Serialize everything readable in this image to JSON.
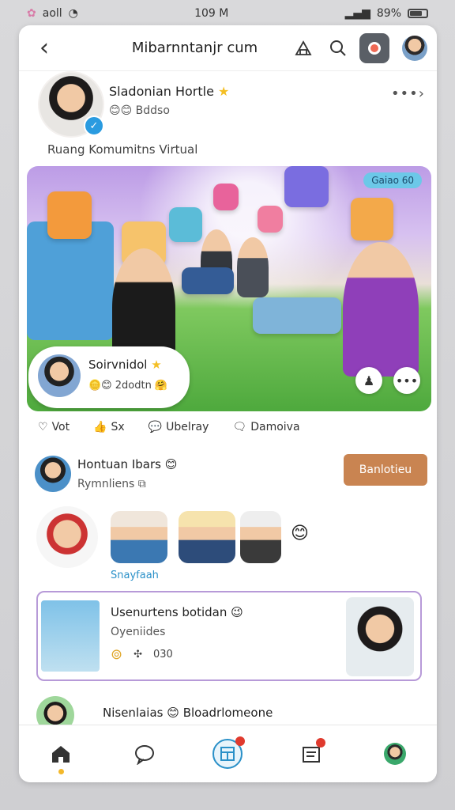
{
  "status_bar": {
    "left_text": "aoll",
    "time": "109 M",
    "battery": "89%"
  },
  "topbar": {
    "site": "Mibarnntanjr cum",
    "back_icon": "back-arrow-icon"
  },
  "profile": {
    "name": "Sladonian Hortle",
    "sub": "Bddso",
    "tagline": "Ruang Komumitns Virtual"
  },
  "hero": {
    "badge": "Gaiao 60",
    "overlay": {
      "name": "Soirvnidol",
      "sub": "2dodtn"
    }
  },
  "actions": [
    {
      "icon": "heart-icon",
      "label": "Vot"
    },
    {
      "icon": "thumbs-up-icon",
      "label": "Sx"
    },
    {
      "icon": "comment-icon",
      "label": "Ubelray"
    },
    {
      "icon": "message-icon",
      "label": "Damoiva"
    }
  ],
  "post2": {
    "name": "Hontuan Ibars",
    "sub": "Rymnliens",
    "follow_label": "Banlotieu"
  },
  "stories": {
    "label": "Snayfaah"
  },
  "featured": {
    "title": "Usenurtens botidan",
    "sub": "Oyeniides",
    "meta_count": "030"
  },
  "peek": {
    "text": "Nisenlaias",
    "text2": "Bloadrlomeone"
  },
  "tabs": [
    {
      "name": "home",
      "icon": "home-icon"
    },
    {
      "name": "chat",
      "icon": "chat-icon"
    },
    {
      "name": "center",
      "icon": "grid-icon"
    },
    {
      "name": "notes",
      "icon": "notes-icon"
    },
    {
      "name": "profile",
      "icon": "profile-icon"
    }
  ]
}
